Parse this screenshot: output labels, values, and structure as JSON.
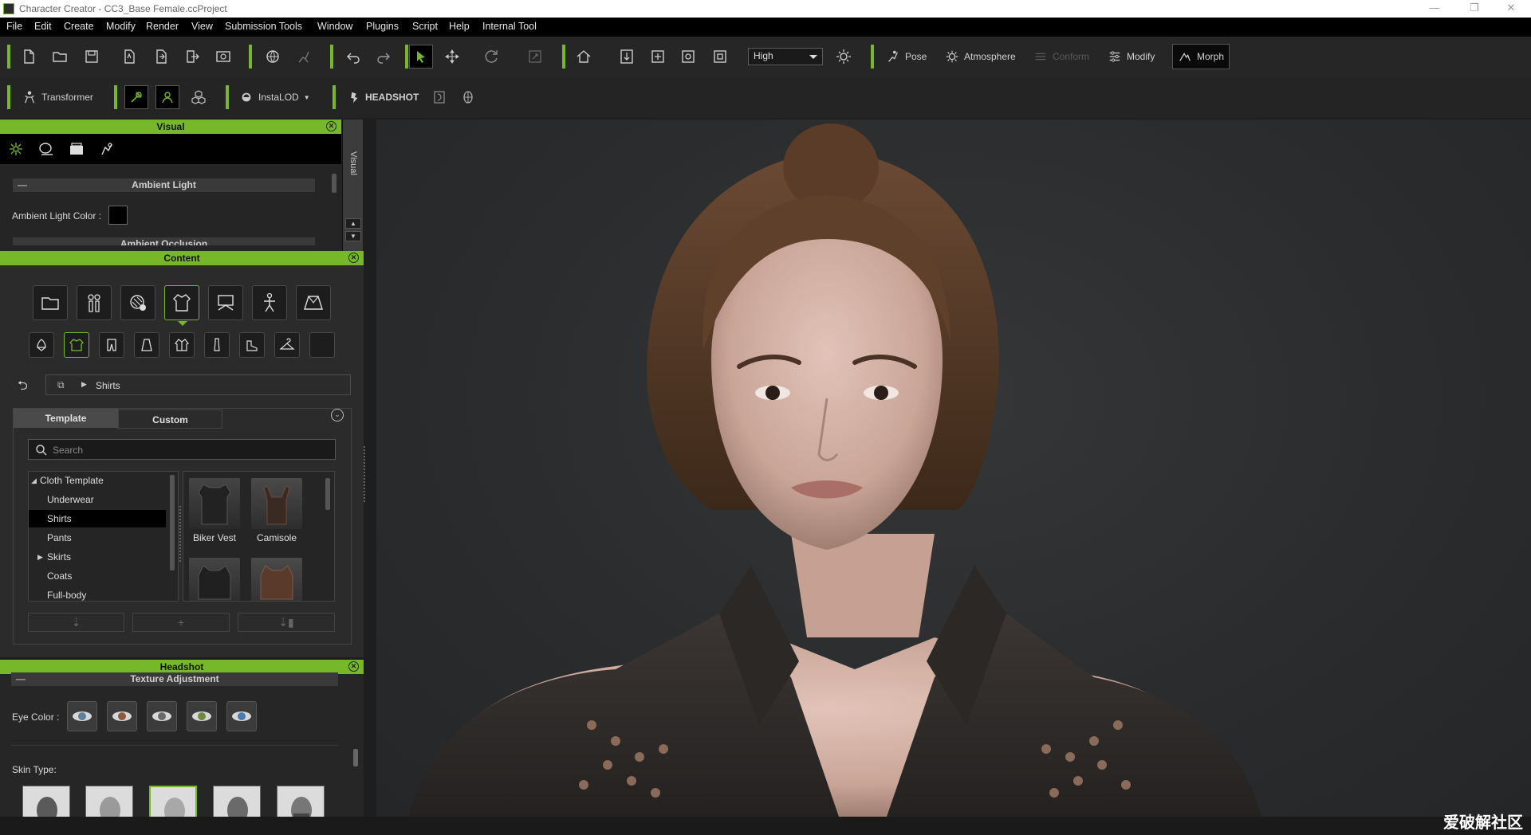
{
  "window": {
    "title": "Character Creator - CC3_Base Female.ccProject",
    "controls": {
      "minimize": "—",
      "maximize": "❐",
      "close": "✕"
    }
  },
  "menu": [
    "File",
    "Edit",
    "Create",
    "Modify",
    "Render",
    "View",
    "Submission Tools",
    "Window",
    "Plugins",
    "Script",
    "Help",
    "Internal Tool"
  ],
  "toolbar": {
    "quality": "High",
    "pose_label": "Pose",
    "atmosphere_label": "Atmosphere",
    "conform_label": "Conform",
    "modify_label": "Modify",
    "morph_label": "Morph",
    "transformer_label": "Transformer",
    "instalod_label": "InstaLOD",
    "headshot_label": "HEADSHOT"
  },
  "visual_panel": {
    "title": "Visual",
    "side_label": "Visual",
    "section_ambient_light": "Ambient Light",
    "ambient_light_color_label": "Ambient Light Color :",
    "ambient_light_color": "#000000",
    "section_ambient_occlusion": "Ambient Occlusion"
  },
  "content_panel": {
    "title": "Content",
    "path": "Shirts",
    "tabs": {
      "template": "Template",
      "custom": "Custom"
    },
    "search_placeholder": "Search",
    "tree": {
      "root": "Cloth Template",
      "items": [
        "Underwear",
        "Shirts",
        "Pants",
        "Skirts",
        "Coats",
        "Full-body"
      ],
      "selected": "Shirts"
    },
    "gallery": [
      "Biker Vest",
      "Camisole"
    ]
  },
  "headshot_panel": {
    "title": "Headshot",
    "section_texture_adjustment": "Texture Adjustment",
    "eye_color_label": "Eye Color :",
    "eye_colors": [
      "#5f7f9a",
      "#8a5a3a",
      "#6a6a6a",
      "#6f8a3f",
      "#4a7ab0"
    ],
    "skin_type_label": "Skin Type:"
  },
  "watermark": "爱破解社区",
  "colors": {
    "accent": "#76b82a",
    "background": "#1e1e1e",
    "panel": "#2b2b2b"
  }
}
